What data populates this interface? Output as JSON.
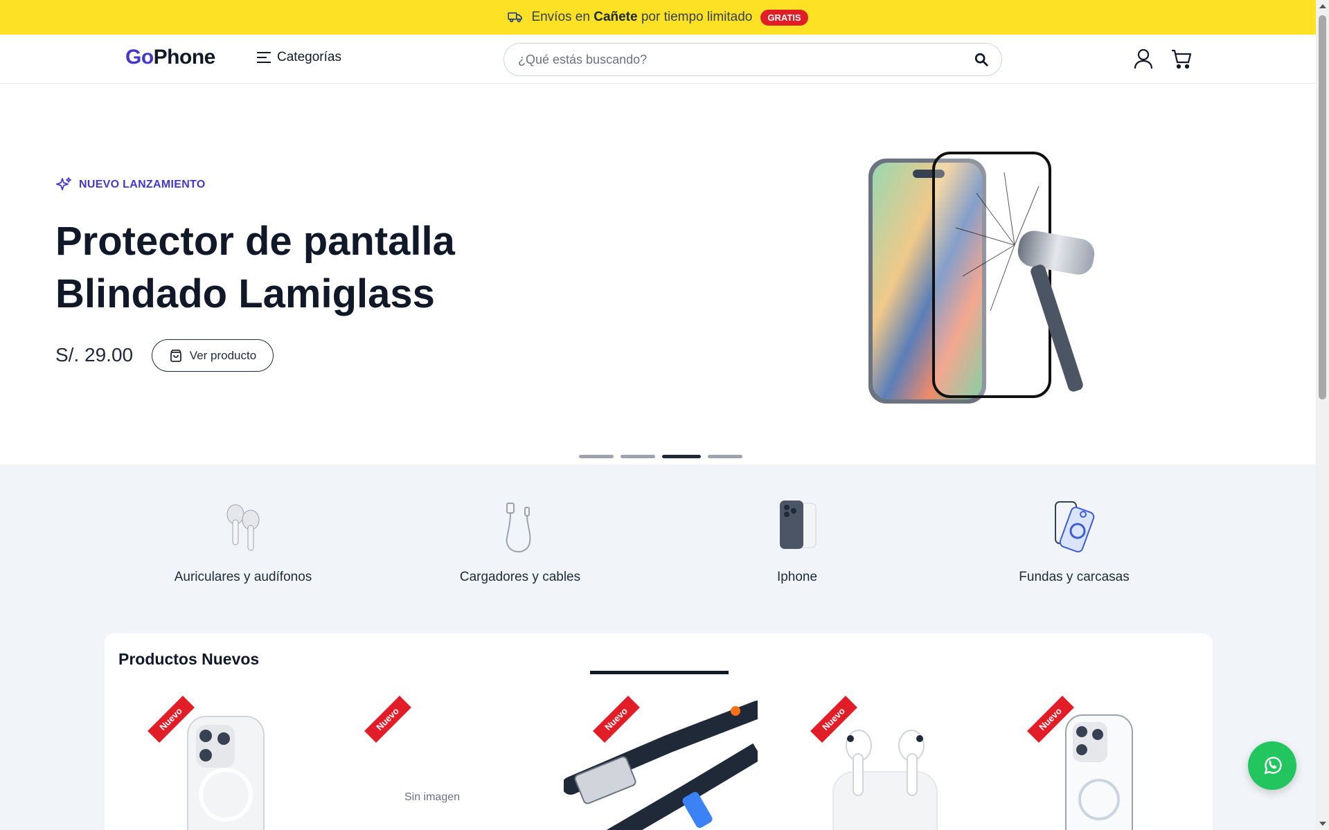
{
  "announcement": {
    "prefix": "Envíos en",
    "place": "Cañete",
    "suffix": "por tiempo limitado",
    "badge": "GRATIS",
    "icon": "truck-icon"
  },
  "header": {
    "logo_a": "Go",
    "logo_b": "Phone",
    "categories_label": "Categorías",
    "search_placeholder": "¿Qué estás buscando?",
    "search_value": ""
  },
  "hero": {
    "tag": "NUEVO LANZAMIENTO",
    "title_line1": "Protector de pantalla",
    "title_line2": "Blindado Lamiglass",
    "price": "S/. 29.00",
    "button_label": "Ver producto",
    "slides_total": 4,
    "active_slide": 3
  },
  "categories": [
    {
      "label": "Auriculares y audífonos",
      "icon": "earbuds-icon"
    },
    {
      "label": "Cargadores y cables",
      "icon": "cable-icon"
    },
    {
      "label": "Iphone",
      "icon": "iphone-icon"
    },
    {
      "label": "Fundas y carcasas",
      "icon": "case-icon"
    }
  ],
  "products_section": {
    "title": "Productos Nuevos",
    "ribbon": "Nuevo",
    "products": [
      {
        "image": "phone-case-magsafe"
      },
      {
        "image": "none",
        "placeholder": "Sin imagen"
      },
      {
        "image": "usb-cable-3a"
      },
      {
        "image": "airpods-pro"
      },
      {
        "image": "clear-magsafe-case"
      }
    ]
  },
  "colors": {
    "topbar": "#fde124",
    "brand": "#4338ca",
    "badge": "#e11d28",
    "whatsapp": "#22c55e",
    "section_bg": "#f1f4f8"
  }
}
